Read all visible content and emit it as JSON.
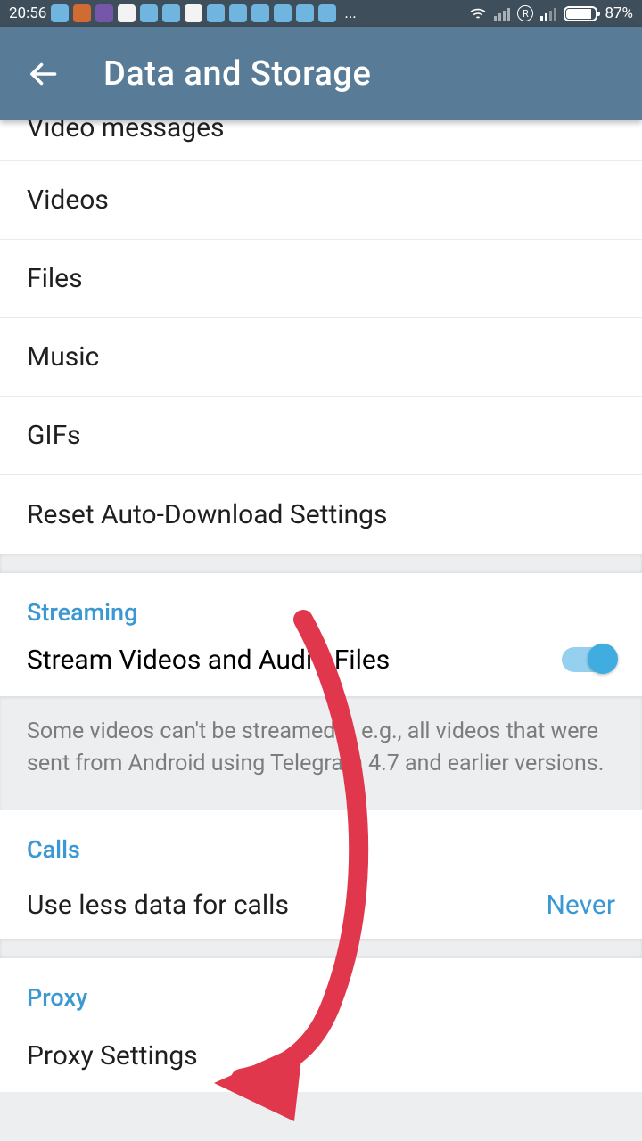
{
  "status": {
    "time": "20:56",
    "battery": "87%",
    "dots": "..."
  },
  "appbar": {
    "title": "Data and Storage"
  },
  "list": {
    "video_messages": "Video messages",
    "videos": "Videos",
    "files": "Files",
    "music": "Music",
    "gifs": "GIFs",
    "reset": "Reset Auto-Download Settings"
  },
  "streaming": {
    "header": "Streaming",
    "toggle_label": "Stream Videos and Audio Files",
    "hint": "Some videos can't be streamed – e.g., all videos that were sent from Android using Telegram 4.7 and earlier versions."
  },
  "calls": {
    "header": "Calls",
    "item": "Use less data for calls",
    "value": "Never"
  },
  "proxy": {
    "header": "Proxy",
    "item": "Proxy Settings"
  }
}
